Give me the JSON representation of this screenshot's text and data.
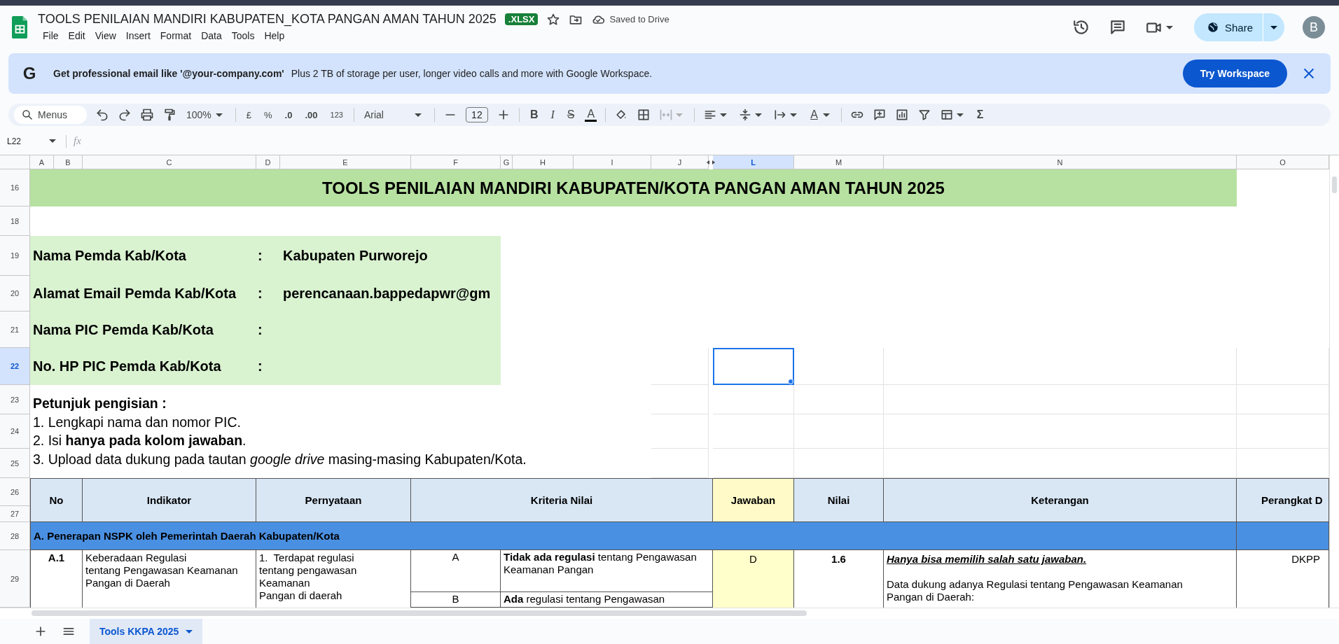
{
  "document": {
    "title": "TOOLS PENILAIAN MANDIRI KABUPATEN_KOTA PANGAN AMAN TAHUN 2025",
    "badge": ".XLSX",
    "save_status": "Saved to Drive"
  },
  "menu": [
    "File",
    "Edit",
    "View",
    "Insert",
    "Format",
    "Data",
    "Tools",
    "Help"
  ],
  "share": {
    "label": "Share"
  },
  "avatar": "B",
  "banner": {
    "logo": "G",
    "headline": "Get professional email like '@your-company.com'",
    "text": "Plus 2 TB of storage per user, longer video calls and more with Google Workspace.",
    "button": "Try Workspace"
  },
  "toolbar": {
    "search_placeholder": "Menus",
    "zoom": "100%",
    "currency": "£",
    "percent": "%",
    "decrease_decimals": ".0",
    "increase_decimals": ".00",
    "number_format": "123",
    "font": "Arial",
    "font_size": "12",
    "bold": "B",
    "italic": "I",
    "strikethrough": "S",
    "text_color": "A",
    "text_rotation": "A",
    "merge_disabled": true,
    "functions": "Σ"
  },
  "formula_bar": {
    "cell_ref": "L22",
    "fx": "fx"
  },
  "columns": [
    {
      "label": "A",
      "selected": false
    },
    {
      "label": "B",
      "selected": false
    },
    {
      "label": "C",
      "selected": false
    },
    {
      "label": "D",
      "selected": false
    },
    {
      "label": "E",
      "selected": false
    },
    {
      "label": "F",
      "selected": false
    },
    {
      "label": "G",
      "selected": false
    },
    {
      "label": "H",
      "selected": false
    },
    {
      "label": "I",
      "selected": false
    },
    {
      "label": "J",
      "selected": false
    },
    {
      "label": "L",
      "selected": true
    },
    {
      "label": "M",
      "selected": false
    },
    {
      "label": "N",
      "selected": false
    },
    {
      "label": "O",
      "selected": false
    }
  ],
  "rows": [
    {
      "label": "16",
      "selected": false
    },
    {
      "label": "18",
      "selected": false
    },
    {
      "label": "19",
      "selected": false
    },
    {
      "label": "20",
      "selected": false
    },
    {
      "label": "21",
      "selected": false
    },
    {
      "label": "22",
      "selected": true
    },
    {
      "label": "23",
      "selected": false
    },
    {
      "label": "24",
      "selected": false
    },
    {
      "label": "25",
      "selected": false
    },
    {
      "label": "26",
      "selected": false
    },
    {
      "label": "27",
      "selected": false
    },
    {
      "label": "28",
      "selected": false
    },
    {
      "label": "29",
      "selected": false
    }
  ],
  "sheet": {
    "title": "TOOLS PENILAIAN MANDIRI KABUPATEN/KOTA PANGAN AMAN TAHUN 2025",
    "fields": [
      {
        "label": "Nama Pemda Kab/Kota",
        "separator": ":",
        "value": "Kabupaten Purworejo"
      },
      {
        "label": "Alamat Email Pemda Kab/Kota",
        "separator": ":",
        "value": "perencanaan.bappedapwr@gm"
      },
      {
        "label": "Nama PIC Pemda Kab/Kota",
        "separator": ":"
      },
      {
        "label": "No. HP PIC Pemda Kab/Kota",
        "separator": ":"
      }
    ],
    "instructions": {
      "heading": "Petunjuk pengisian :",
      "items": [
        "1. Lengkapi nama dan nomor PIC.",
        "2. Isi **hanya pada kolom jawaban**.",
        "3. Upload data dukung pada tautan *google drive* masing-masing Kabupaten/Kota."
      ]
    },
    "table": {
      "columns": [
        {
          "label": "No",
          "kind": "plain"
        },
        {
          "label": "Indikator",
          "kind": "plain"
        },
        {
          "label": "Pernyataan",
          "kind": "plain"
        },
        {
          "label": "Kriteria Nilai",
          "kind": "plain"
        },
        {
          "label": "Jawaban",
          "kind": "answer"
        },
        {
          "label": "Nilai",
          "kind": "plain"
        },
        {
          "label": "Keterangan",
          "kind": "plain"
        },
        {
          "label": "Perangkat D",
          "kind": "plain"
        }
      ],
      "section": "A. Penerapan NSPK oleh Pemerintah Daerah Kabupaten/Kota",
      "record": {
        "no": "A.1",
        "indikator": "Keberadaan Regulasi\ntentang Pengawasan Keamanan\nPangan di Daerah",
        "pernyataan": "1.  Terdapat regulasi\ntentang pengawasan\nKeamanan\nPangan di daerah",
        "criteria": [
          {
            "grade": "A",
            "text": "**Tidak ada regulasi** tentang Pengawasan Keamanan Pangan"
          },
          {
            "grade": "B",
            "text": "**Ada** regulasi tentang Pengawasan"
          }
        ],
        "jawaban": "D",
        "nilai": "1.6",
        "keterangan_note": "Hanya bisa memilih salah satu jawaban.",
        "keterangan_text": "Data dukung adanya Regulasi tentang Pengawasan Keamanan Pangan di Daerah:",
        "perangkat": "DKPP"
      }
    }
  },
  "sheet_tabs": [
    {
      "label": "Tools KKPA 2025",
      "selected": true
    }
  ]
}
